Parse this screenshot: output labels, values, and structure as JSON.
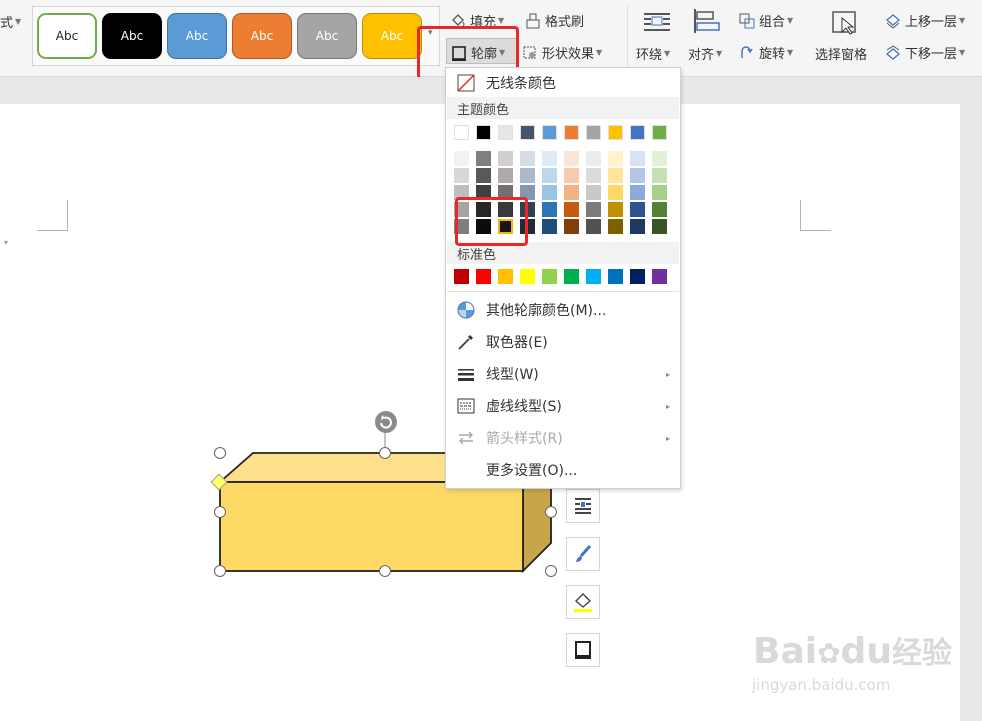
{
  "ribbon": {
    "left_partial_label": "式",
    "style_swatches": [
      {
        "label": "Abc",
        "bg": "#ffffff",
        "fg": "#222222",
        "border": "#70ad47"
      },
      {
        "label": "Abc",
        "bg": "#000000",
        "fg": "#ffffff",
        "border": "#000000"
      },
      {
        "label": "Abc",
        "bg": "#5b9bd5",
        "fg": "#ffffff",
        "border": "#41719c"
      },
      {
        "label": "Abc",
        "bg": "#ed7d31",
        "fg": "#ffffff",
        "border": "#ae5a21"
      },
      {
        "label": "Abc",
        "bg": "#a5a5a5",
        "fg": "#ffffff",
        "border": "#787878"
      },
      {
        "label": "Abc",
        "bg": "#ffc000",
        "fg": "#ffffff",
        "border": "#bc8c00"
      }
    ],
    "fill": "填充",
    "format_painter": "格式刷",
    "outline": "轮廓",
    "shape_effects": "形状效果",
    "wrap": "环绕",
    "align": "对齐",
    "group": "组合",
    "rotate": "旋转",
    "selection_pane": "选择窗格",
    "bring_forward": "上移一层",
    "send_backward": "下移一层"
  },
  "outline_menu": {
    "no_line": "无线条颜色",
    "theme_title": "主题颜色",
    "theme_top": [
      "#ffffff",
      "#000000",
      "#e7e6e6",
      "#44546a",
      "#5b9bd5",
      "#ed7d31",
      "#a5a5a5",
      "#ffc000",
      "#4472c4",
      "#70ad47"
    ],
    "theme_shades": [
      [
        "#f2f2f2",
        "#d8d8d8",
        "#bfbfbf",
        "#a5a5a5",
        "#7f7f7f"
      ],
      [
        "#7f7f7f",
        "#595959",
        "#3f3f3f",
        "#262626",
        "#0c0c0c"
      ],
      [
        "#d0cece",
        "#aeaaaa",
        "#757070",
        "#3a3838",
        "#171616"
      ],
      [
        "#d6dce4",
        "#adb9ca",
        "#8496b0",
        "#333f4f",
        "#222a35"
      ],
      [
        "#deebf6",
        "#bdd7ee",
        "#9cc3e5",
        "#2e75b5",
        "#1e4e79"
      ],
      [
        "#fbe5d5",
        "#f7cbac",
        "#f4b183",
        "#c55a11",
        "#833c0b"
      ],
      [
        "#ededed",
        "#dbdbdb",
        "#c9c9c9",
        "#7b7b7b",
        "#525252"
      ],
      [
        "#fff2cc",
        "#fee599",
        "#ffd965",
        "#bf9000",
        "#7f6000"
      ],
      [
        "#d9e2f3",
        "#b4c6e7",
        "#8eaadb",
        "#2f5496",
        "#1f3864"
      ],
      [
        "#e2efd9",
        "#c5e0b3",
        "#a8d08d",
        "#538135",
        "#375623"
      ]
    ],
    "standard_title": "标准色",
    "standard": [
      "#c00000",
      "#ff0000",
      "#ffc000",
      "#ffff00",
      "#92d050",
      "#00b050",
      "#00b0f0",
      "#0070c0",
      "#002060",
      "#7030a0"
    ],
    "more_colors": "其他轮廓颜色(M)...",
    "eyedropper": "取色器(E)",
    "line_type": "线型(W)",
    "dash_type": "虚线线型(S)",
    "arrow_style": "箭头样式(R)",
    "more_settings": "更多设置(O)..."
  },
  "shape": {
    "front": "#ffd966",
    "top": "#ffe08a",
    "side": "#c8a54a"
  },
  "watermark": {
    "brand_a": "Bai",
    "brand_b": "du",
    "brand_c": "经验",
    "url": "jingyan.baidu.com"
  },
  "highlight_color": "#e8282a"
}
